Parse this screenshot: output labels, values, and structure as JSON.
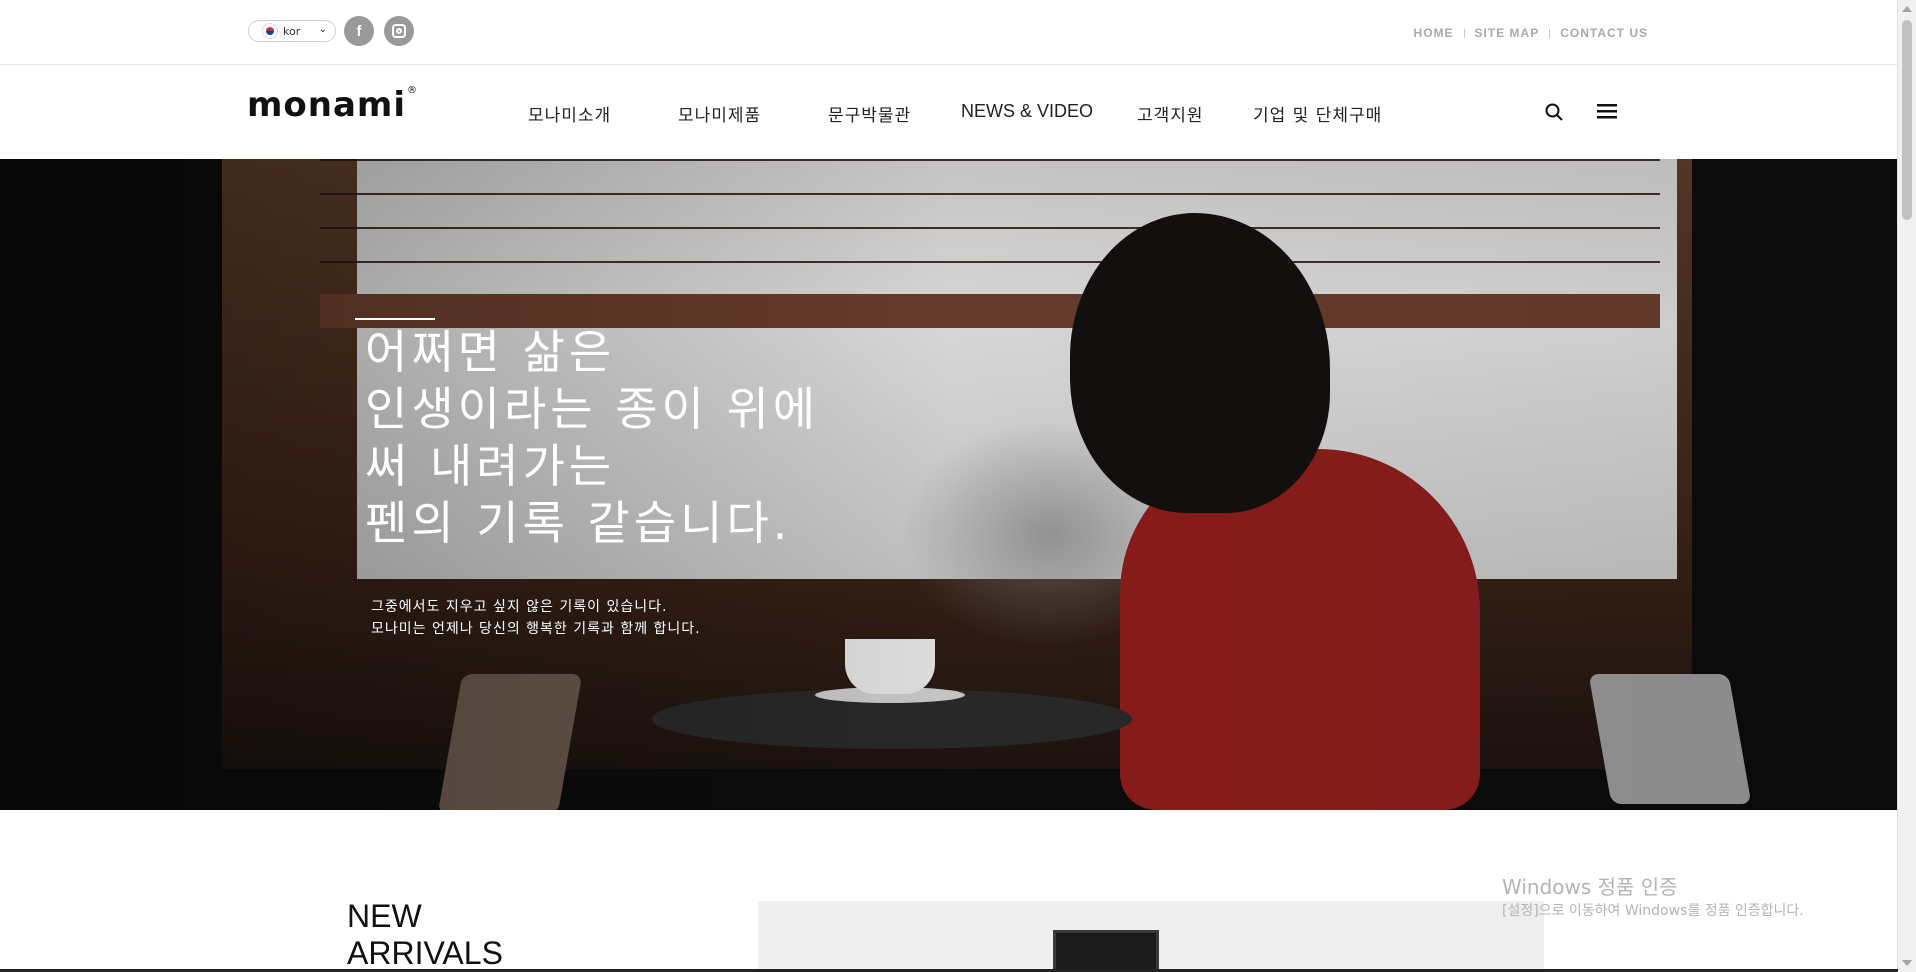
{
  "topbar": {
    "language": {
      "selected": "kor",
      "icon": "korea-flag-icon"
    },
    "social": [
      {
        "name": "facebook",
        "icon": "facebook-icon",
        "glyph": "f"
      },
      {
        "name": "instagram",
        "icon": "instagram-icon"
      }
    ],
    "utility_links": [
      "HOME",
      "SITE MAP",
      "CONTACT US"
    ]
  },
  "header": {
    "logo": "monami",
    "logo_mark": "®",
    "nav": [
      "모나미소개",
      "모나미제품",
      "문구박물관",
      "NEWS & VIDEO",
      "고객지원",
      "기업 및 단체구매"
    ],
    "icons": [
      "search-icon",
      "hamburger-menu-icon"
    ]
  },
  "hero": {
    "headline": [
      "어쩌면 삶은",
      "인생이라는 종이 위에",
      "써 내려가는",
      "펜의 기록 같습니다."
    ],
    "subtext": [
      "그중에서도 지우고 싶지 않은 기록이 있습니다.",
      "모나미는 언제나 당신의 행복한 기록과 함께 합니다."
    ]
  },
  "section": {
    "title_lines": [
      "NEW",
      "ARRIVALS"
    ]
  },
  "watermark": {
    "title": "Windows 정품 인증",
    "subtitle": "[설정]으로 이동하여 Windows를 정품 인증합니다."
  },
  "colors": {
    "accent_red": "#8e1e1c",
    "utility_grey": "#aaaaaa",
    "social_grey": "#9a9a9a"
  }
}
